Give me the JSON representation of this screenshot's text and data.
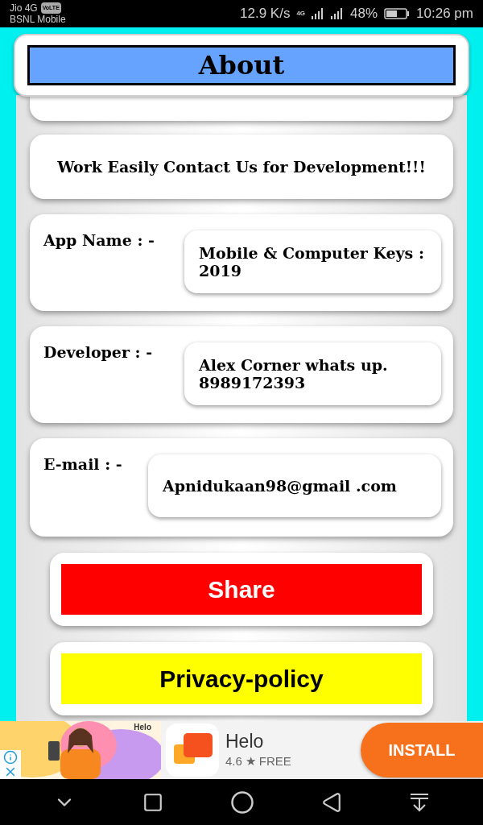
{
  "status_bar": {
    "carrier_1": "Jio 4G",
    "volte": "VoLTE",
    "carrier_2": "BSNL Mobile",
    "speed": "12.9 K/s",
    "network": "4G",
    "battery": "48%",
    "time": "10:26 pm"
  },
  "header": {
    "title": "About"
  },
  "intro": {
    "text": "Work Easily Contact Us for Development!!!"
  },
  "fields": [
    {
      "label": "App Name : -",
      "value": "Mobile & Computer Keys : 2019"
    },
    {
      "label": "Developer : -",
      "value": "Alex Corner whats up. 8989172393"
    },
    {
      "label": "E-mail : -",
      "value": "Apnidukaan98@gmail .com"
    }
  ],
  "buttons": [
    {
      "label": "Share",
      "color": "#ff0000"
    },
    {
      "label": "Privacy-policy",
      "color": "#ffff00"
    }
  ],
  "ad": {
    "image_brand": "Helo",
    "app_name": "Helo",
    "rating": "4.6",
    "star": "★",
    "price": "FREE",
    "install": "INSTALL"
  }
}
